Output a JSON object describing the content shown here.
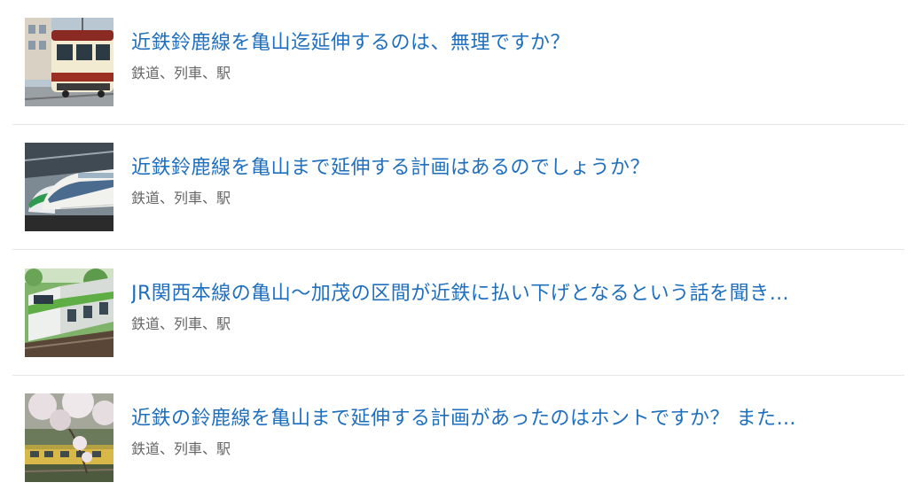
{
  "questions": [
    {
      "title": "近鉄鈴鹿線を亀山迄延伸するのは、無理ですか？",
      "tags": "鉄道、列車、駅",
      "thumbnail": "streetcar-photo"
    },
    {
      "title": "近鉄鈴鹿線を亀山まで延伸する計画はあるのでしょうか？",
      "tags": "鉄道、列車、駅",
      "thumbnail": "shinkansen-photo"
    },
    {
      "title": "JR関西本線の亀山〜加茂の区間が近鉄に払い下げとなるという話を聞き…",
      "tags": "鉄道、列車、駅",
      "thumbnail": "green-commuter-train-photo"
    },
    {
      "title": "近鉄の鈴鹿線を亀山まで延伸する計画があったのはホントですか？ また…",
      "tags": "鉄道、列車、駅",
      "thumbnail": "cherry-blossom-train-photo"
    }
  ],
  "colors": {
    "title_link": "#1f6fbf",
    "tag_text": "#666666",
    "separator": "#e6e6e6"
  }
}
